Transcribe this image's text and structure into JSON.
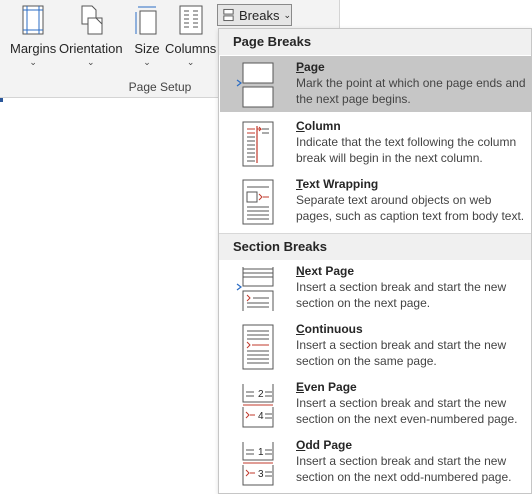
{
  "ribbon": {
    "margins_label": "Margins",
    "orientation_label": "Orientation",
    "size_label": "Size",
    "columns_label": "Columns",
    "breaks_label": "Breaks",
    "group_label": "Page Setup"
  },
  "menu": {
    "page_breaks": {
      "heading": "Page Breaks",
      "items": [
        {
          "acc": "P",
          "rest": "age",
          "desc": "Mark the point at which one page ends and the next page begins."
        },
        {
          "acc": "C",
          "rest": "olumn",
          "desc": "Indicate that the text following the column break will begin in the next column."
        },
        {
          "acc": "T",
          "rest": "ext Wrapping",
          "desc": "Separate text around objects on web pages, such as caption text from body text."
        }
      ]
    },
    "section_breaks": {
      "heading": "Section Breaks",
      "items": [
        {
          "acc": "N",
          "rest": "ext Page",
          "desc": "Insert a section break and start the new section on the next page."
        },
        {
          "acc": "C",
          "rest": "ontinuous",
          "desc": "Insert a section break and start the new section on the same page."
        },
        {
          "acc": "E",
          "rest": "ven Page",
          "desc": "Insert a section break and start the new section on the next even-numbered page."
        },
        {
          "acc": "O",
          "rest": "dd Page",
          "desc": "Insert a section break and start the new section on the next odd-numbered page."
        }
      ]
    },
    "even_page_icon_numbers": [
      "2",
      "4"
    ],
    "odd_page_icon_numbers": [
      "1",
      "3"
    ]
  },
  "colors": {
    "accent_red": "#c0392b",
    "caret_blue": "#2b6cc4",
    "highlight": "#c6c6c6"
  }
}
